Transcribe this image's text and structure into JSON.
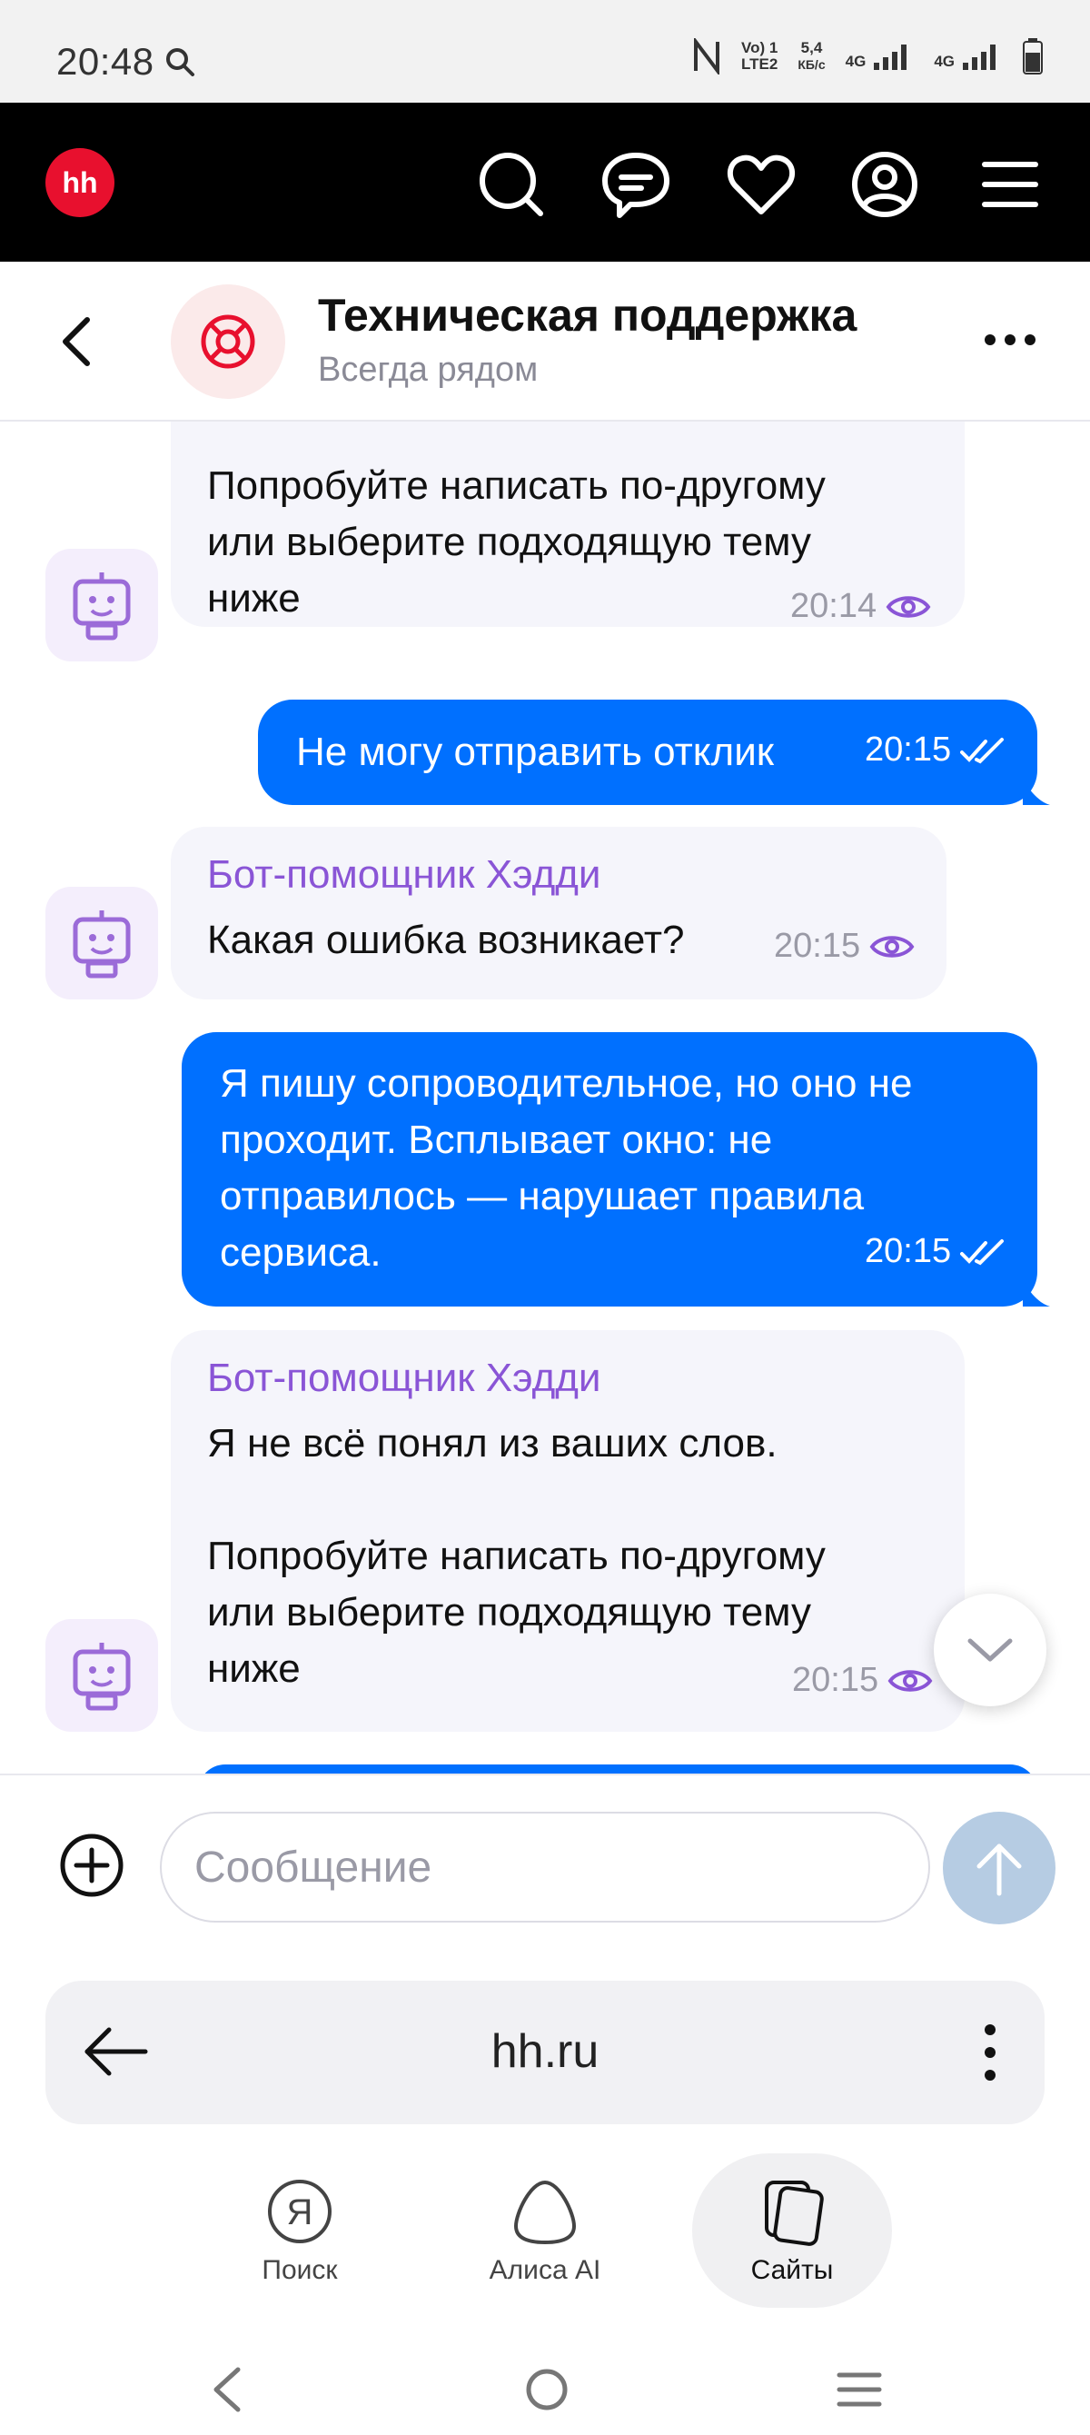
{
  "status_bar": {
    "time": "20:48",
    "volte": "Vo) 1",
    "lte2": "LTE2",
    "speed_value": "5,4",
    "speed_unit": "КБ/с",
    "net1": "4G",
    "net2": "4G"
  },
  "app_header": {
    "logo": "hh"
  },
  "chat_header": {
    "title": "Техническая поддержка",
    "subtitle": "Всегда рядом"
  },
  "messages": [
    {
      "type": "in",
      "lines": [
        "Попробуйте написать по-другому",
        "или выберите подходящую тему",
        "ниже"
      ],
      "time": "20:14"
    },
    {
      "type": "out",
      "text": "Не могу отправить отклик",
      "time": "20:15"
    },
    {
      "type": "in",
      "sender": "Бот-помощник Хэдди",
      "text": "Какая ошибка возникает?",
      "time": "20:15"
    },
    {
      "type": "out",
      "lines": [
        "Я пишу сопроводительное, но оно не",
        "проходит. Всплывает окно: не",
        "отправилось — нарушает правила",
        "сервиса."
      ],
      "time": "20:15"
    },
    {
      "type": "in",
      "sender": "Бот-помощник Хэдди",
      "line1": "Я не всё понял из ваших слов.",
      "lines": [
        "Попробуйте написать по-другому",
        "или выберите подходящую тему",
        "ниже"
      ],
      "time": "20:15"
    }
  ],
  "composer": {
    "placeholder": "Сообщение"
  },
  "browser": {
    "url": "hh.ru",
    "tabs": [
      {
        "label": "Поиск"
      },
      {
        "label": "Алиса AI"
      },
      {
        "label": "Сайты"
      }
    ]
  },
  "colors": {
    "accent_blue": "#0070ff",
    "brand_red": "#e8102e",
    "bot_purple": "#8a55d6"
  }
}
